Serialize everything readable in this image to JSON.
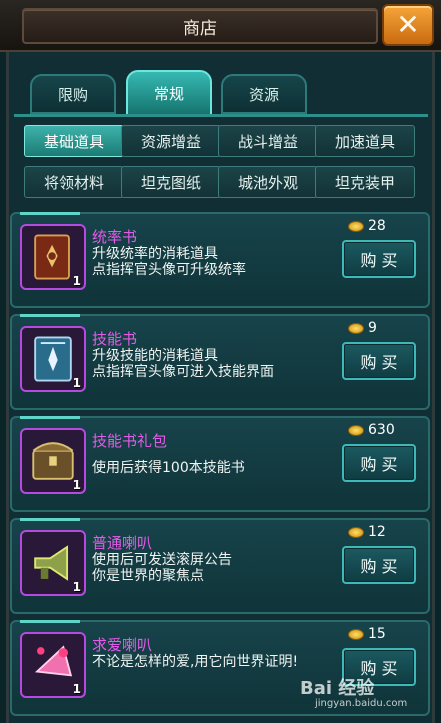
{
  "header": {
    "title": "商店",
    "close_icon": "close-icon"
  },
  "tabs": [
    {
      "label": "限购",
      "active": false
    },
    {
      "label": "常规",
      "active": true
    },
    {
      "label": "资源",
      "active": false
    }
  ],
  "categories": [
    {
      "label": "基础道具",
      "active": true
    },
    {
      "label": "资源增益",
      "active": false
    },
    {
      "label": "战斗增益",
      "active": false
    },
    {
      "label": "加速道具",
      "active": false
    },
    {
      "label": "将领材料",
      "active": false
    },
    {
      "label": "坦克图纸",
      "active": false
    },
    {
      "label": "城池外观",
      "active": false
    },
    {
      "label": "坦克装甲",
      "active": false
    }
  ],
  "items": [
    {
      "name": "统率书",
      "desc": "升级统率的消耗道具\n点指挥官头像可升级统率",
      "price": "28",
      "qty": "1",
      "buy": "购 买",
      "icon": "command-book-icon"
    },
    {
      "name": "技能书",
      "desc": "升级技能的消耗道具\n点指挥官头像可进入技能界面",
      "price": "9",
      "qty": "1",
      "buy": "购 买",
      "icon": "skill-book-icon"
    },
    {
      "name": "技能书礼包",
      "desc": "使用后获得100本技能书",
      "price": "630",
      "qty": "1",
      "buy": "购 买",
      "icon": "treasure-chest-icon"
    },
    {
      "name": "普通喇叭",
      "desc": "使用后可发送滚屏公告\n你是世界的聚焦点",
      "price": "12",
      "qty": "1",
      "buy": "购 买",
      "icon": "megaphone-icon"
    },
    {
      "name": "求爱喇叭",
      "desc": "不论是怎样的爱,用它向世界证明!",
      "price": "15",
      "qty": "1",
      "buy": "购 买",
      "icon": "love-horn-icon"
    }
  ],
  "watermark": {
    "text": "Bai 经验",
    "sub": "jingyan.baidu.com"
  },
  "colors": {
    "item_name": "#e35be8",
    "accent": "#3db3ab",
    "close": "#f5a53a"
  }
}
